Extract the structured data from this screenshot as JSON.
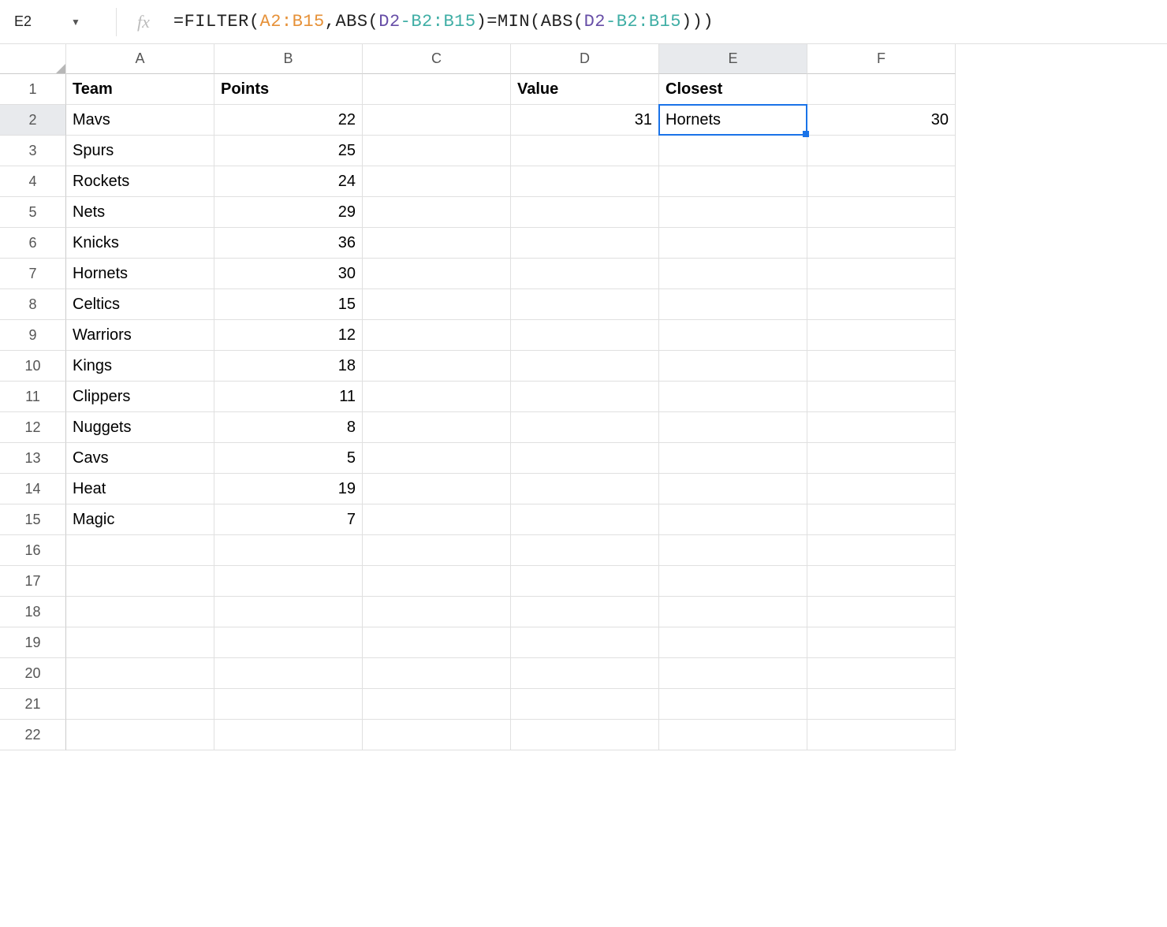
{
  "nameBox": "E2",
  "formula": {
    "parts": [
      {
        "t": "=FILTER",
        "cls": "tok-fn"
      },
      {
        "t": "(",
        "cls": "tok-paren"
      },
      {
        "t": "A2:B15",
        "cls": "tok-range-a"
      },
      {
        "t": ",",
        "cls": "tok-comma"
      },
      {
        "t": "ABS",
        "cls": "tok-fn"
      },
      {
        "t": "(",
        "cls": "tok-paren"
      },
      {
        "t": "D2",
        "cls": "tok-ref-d"
      },
      {
        "t": "-",
        "cls": "tok-op"
      },
      {
        "t": "B2:B15",
        "cls": "tok-range-b"
      },
      {
        "t": ")",
        "cls": "tok-paren"
      },
      {
        "t": "=MIN",
        "cls": "tok-fn"
      },
      {
        "t": "(",
        "cls": "tok-paren"
      },
      {
        "t": "ABS",
        "cls": "tok-fn"
      },
      {
        "t": "(",
        "cls": "tok-paren"
      },
      {
        "t": "D2",
        "cls": "tok-ref-d"
      },
      {
        "t": "-",
        "cls": "tok-op"
      },
      {
        "t": "B2:B15",
        "cls": "tok-range-b"
      },
      {
        "t": ")))",
        "cls": "tok-paren"
      }
    ]
  },
  "columns": [
    "A",
    "B",
    "C",
    "D",
    "E",
    "F"
  ],
  "rowCount": 22,
  "activeCell": {
    "row": 2,
    "col": "E"
  },
  "cells": {
    "A1": {
      "v": "Team",
      "type": "text",
      "bold": true
    },
    "B1": {
      "v": "Points",
      "type": "text",
      "bold": true
    },
    "D1": {
      "v": "Value",
      "type": "text",
      "bold": true
    },
    "E1": {
      "v": "Closest",
      "type": "text",
      "bold": true
    },
    "A2": {
      "v": "Mavs",
      "type": "text"
    },
    "B2": {
      "v": "22",
      "type": "num"
    },
    "D2": {
      "v": "31",
      "type": "num"
    },
    "E2": {
      "v": "Hornets",
      "type": "text"
    },
    "F2": {
      "v": "30",
      "type": "num"
    },
    "A3": {
      "v": "Spurs",
      "type": "text"
    },
    "B3": {
      "v": "25",
      "type": "num"
    },
    "A4": {
      "v": "Rockets",
      "type": "text"
    },
    "B4": {
      "v": "24",
      "type": "num"
    },
    "A5": {
      "v": "Nets",
      "type": "text"
    },
    "B5": {
      "v": "29",
      "type": "num"
    },
    "A6": {
      "v": "Knicks",
      "type": "text"
    },
    "B6": {
      "v": "36",
      "type": "num"
    },
    "A7": {
      "v": "Hornets",
      "type": "text"
    },
    "B7": {
      "v": "30",
      "type": "num"
    },
    "A8": {
      "v": "Celtics",
      "type": "text"
    },
    "B8": {
      "v": "15",
      "type": "num"
    },
    "A9": {
      "v": "Warriors",
      "type": "text"
    },
    "B9": {
      "v": "12",
      "type": "num"
    },
    "A10": {
      "v": "Kings",
      "type": "text"
    },
    "B10": {
      "v": "18",
      "type": "num"
    },
    "A11": {
      "v": "Clippers",
      "type": "text"
    },
    "B11": {
      "v": "11",
      "type": "num"
    },
    "A12": {
      "v": "Nuggets",
      "type": "text"
    },
    "B12": {
      "v": "8",
      "type": "num"
    },
    "A13": {
      "v": "Cavs",
      "type": "text"
    },
    "B13": {
      "v": "5",
      "type": "num"
    },
    "A14": {
      "v": "Heat",
      "type": "text"
    },
    "B14": {
      "v": "19",
      "type": "num"
    },
    "A15": {
      "v": "Magic",
      "type": "text"
    },
    "B15": {
      "v": "7",
      "type": "num"
    }
  }
}
